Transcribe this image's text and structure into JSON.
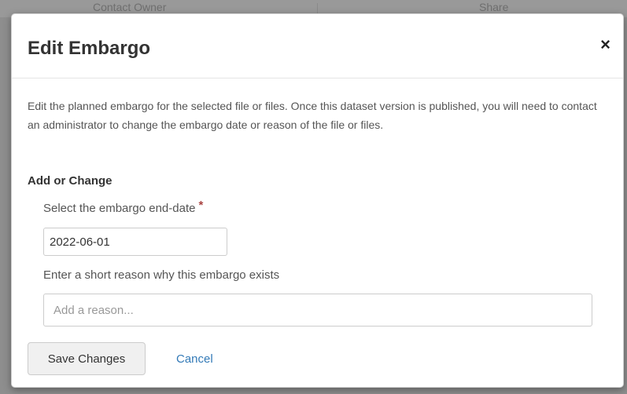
{
  "background": {
    "contact_owner": "Contact Owner",
    "share": "Share"
  },
  "modal": {
    "title": "Edit Embargo",
    "close_symbol": "×",
    "description": "Edit the planned embargo for the selected file or files. Once this dataset version is published, you will need to contact an administrator to change the embargo date or reason of the file or files.",
    "section_label": "Add or Change",
    "date_label": "Select the embargo end-date",
    "required_marker": "*",
    "date_value": "2022-06-01",
    "reason_label": "Enter a short reason why this embargo exists",
    "reason_value": "",
    "reason_placeholder": "Add a reason...",
    "save_label": "Save Changes",
    "cancel_label": "Cancel"
  },
  "colors": {
    "link": "#337ab7",
    "required": "#a94442",
    "overlay": "#8e8e8e"
  }
}
